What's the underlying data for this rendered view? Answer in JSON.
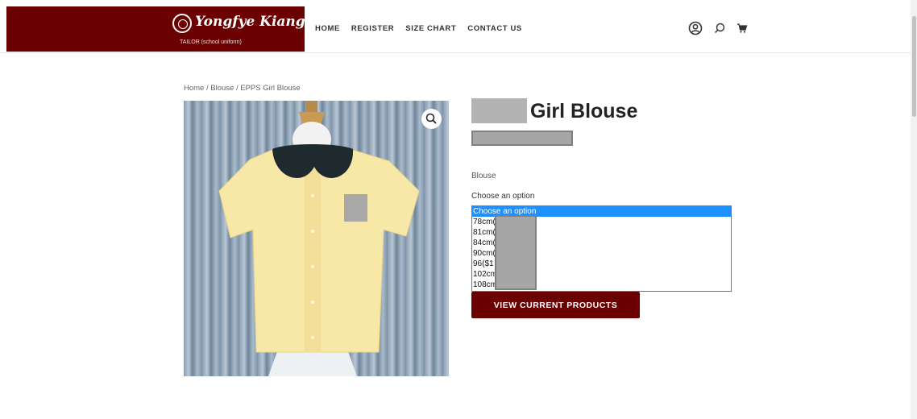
{
  "header": {
    "logo_script": "Yongfye Kiang",
    "logo_subtitle": "TAILOR (school uniform)",
    "nav": [
      {
        "label": "HOME"
      },
      {
        "label": "REGISTER"
      },
      {
        "label": "SIZE CHART"
      },
      {
        "label": "CONTACT US"
      }
    ],
    "icons": [
      "account-icon",
      "search-icon",
      "cart-icon"
    ]
  },
  "breadcrumb": {
    "home": "Home",
    "sep1": " / ",
    "category": "Blouse",
    "sep2": " / ",
    "current": "EPPS Girl Blouse"
  },
  "product": {
    "title": "Girl Blouse",
    "category": "Blouse",
    "choose_label": "Choose an option",
    "options": [
      "Choose an option",
      "78cm(",
      "81cm(",
      "84cm(",
      "90cm(",
      "96($1",
      "102cm",
      "108cm"
    ],
    "selected_option": "Choose an option",
    "view_button": "VIEW CURRENT PRODUCTS"
  },
  "colors": {
    "brand": "#6b0000",
    "selected_option": "#1e90ff"
  }
}
